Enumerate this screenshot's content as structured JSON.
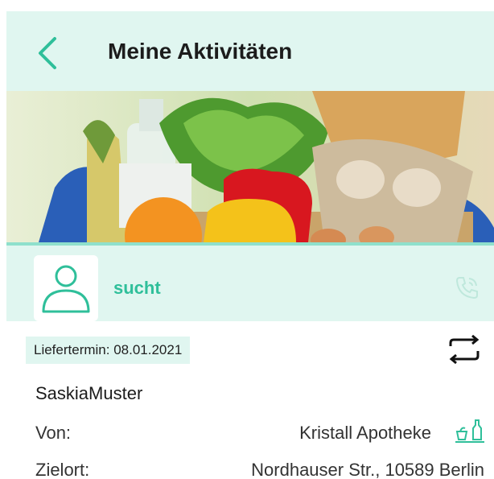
{
  "header": {
    "title": "Meine Aktivitäten",
    "back_icon": "chevron-left-icon"
  },
  "colors": {
    "accent": "#2fbf9a",
    "header_bg": "#e0f6f0",
    "divider": "#8fe0cc"
  },
  "seeker": {
    "avatar_icon": "user-icon",
    "status": "sucht",
    "phone_icon": "phone-icon"
  },
  "order": {
    "delivery_date": "Liefertermin: 08.01.2021",
    "repeat_icon": "repeat-icon",
    "name": "SaskiaMuster",
    "from_label": "Von:",
    "from_value": "Kristall Apotheke",
    "shop_icon": "shopping-icon",
    "destination_label": "Zielort:",
    "destination_value": "Nordhauser Str., 10589 Berlin"
  }
}
